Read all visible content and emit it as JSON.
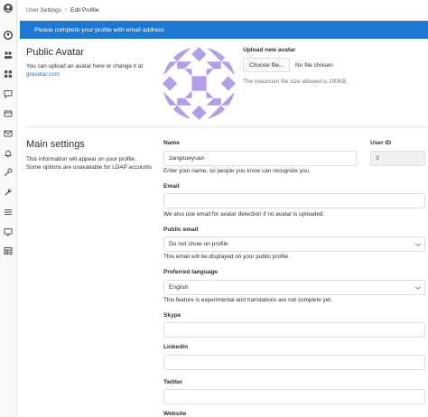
{
  "breadcrumb": {
    "parent": "User Settings",
    "current": "Edit Profile"
  },
  "banner": {
    "text": "Please complete your profile with email address"
  },
  "public_avatar": {
    "title": "Public Avatar",
    "desc_prefix": "You can upload an avatar here or change it at",
    "desc_link": "gravatar.com",
    "upload_label": "Upload new avatar",
    "choose_file_button": "Choose file...",
    "no_file_text": "No file chosen",
    "max_size_note": "The maximum file size allowed is 200KB."
  },
  "main_settings": {
    "title": "Main settings",
    "desc": "This information will appear on your profile. Some options are unavailable for LDAP accounts"
  },
  "form": {
    "name": {
      "label": "Name",
      "value": "zangxueyuan",
      "help": "Enter your name, so people you know can recognize you."
    },
    "user_id": {
      "label": "User ID",
      "value": "3"
    },
    "email": {
      "label": "Email",
      "value": "",
      "help": "We also use email for avatar detection if no avatar is uploaded."
    },
    "public_email": {
      "label": "Public email",
      "value": "Do not show on profile",
      "help": "This email will be displayed on your public profile."
    },
    "preferred_language": {
      "label": "Preferred language",
      "value": "English",
      "help": "This feature is experimental and translations are not complete yet."
    },
    "skype": {
      "label": "Skype",
      "value": ""
    },
    "linkedin": {
      "label": "Linkedin",
      "value": ""
    },
    "twitter": {
      "label": "Twitter",
      "value": ""
    },
    "website": {
      "label": "Website"
    }
  },
  "sidebar": {
    "icons": [
      "user-icon",
      "projects-icon",
      "apps-icon",
      "chat-icon",
      "card-icon",
      "mail-icon",
      "bell-icon",
      "key-icon",
      "wrench-icon",
      "list-icon",
      "monitor-icon",
      "table-icon"
    ]
  },
  "colors": {
    "accent": "#1f78d1",
    "avatar": "#b39de6"
  }
}
